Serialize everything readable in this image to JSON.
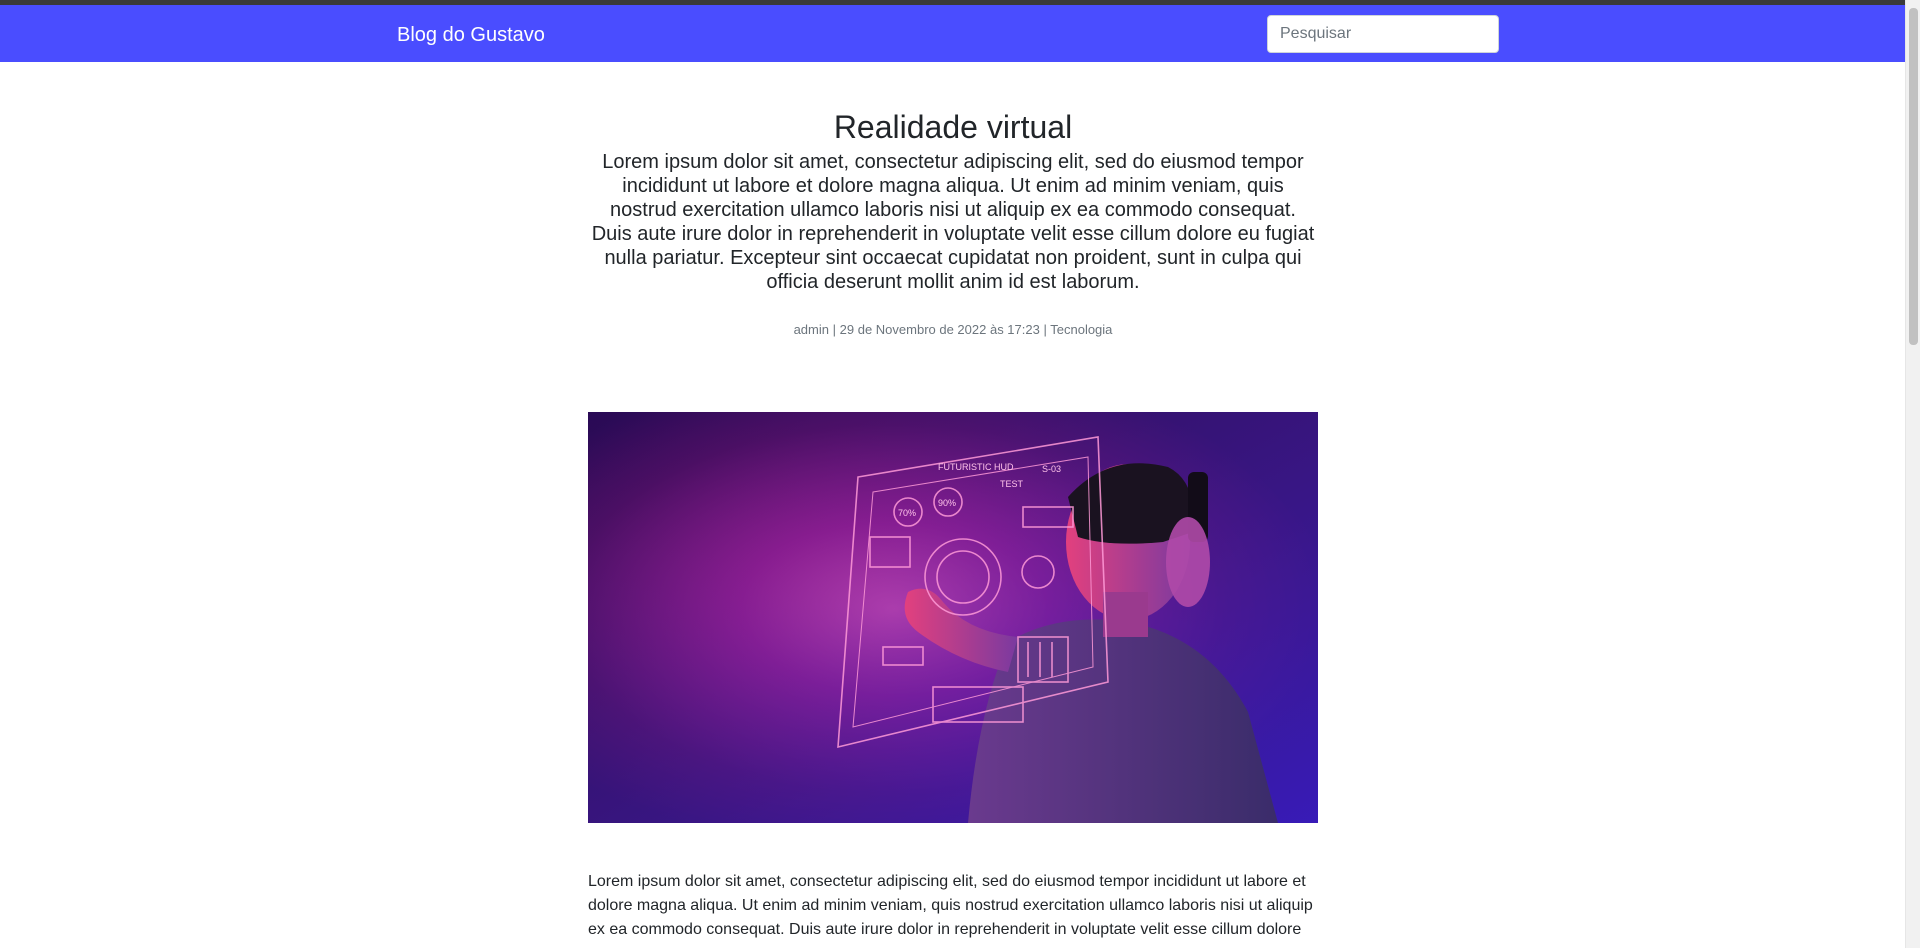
{
  "navbar": {
    "brand": "Blog do Gustavo",
    "search_placeholder": "Pesquisar",
    "accent_color": "#4a4dff"
  },
  "post": {
    "title": "Realidade virtual",
    "summary": "Lorem ipsum dolor sit amet, consectetur adipiscing elit, sed do eiusmod tempor incididunt ut labore et dolore magna aliqua. Ut enim ad minim veniam, quis nostrud exercitation ullamco laboris nisi ut aliquip ex ea commodo consequat. Duis aute irure dolor in reprehenderit in voluptate velit esse cillum dolore eu fugiat nulla pariatur. Excepteur sint occaecat cupidatat non proident, sunt in culpa qui officia deserunt mollit anim id est laborum.",
    "meta": {
      "author": "admin",
      "separator": "|",
      "date": "29 de Novembro de 2022 às 17:23",
      "category": "Tecnologia"
    },
    "image_text": {
      "hud_title": "FUTURISTIC HUD",
      "test_label": "TEST",
      "pct_a": "70%",
      "pct_b": "90%",
      "code": "S-03"
    },
    "body": "Lorem ipsum dolor sit amet, consectetur adipiscing elit, sed do eiusmod tempor incididunt ut labore et dolore magna aliqua. Ut enim ad minim veniam, quis nostrud exercitation ullamco laboris nisi ut aliquip ex ea commodo consequat. Duis aute irure dolor in reprehenderit in voluptate velit esse cillum dolore"
  }
}
